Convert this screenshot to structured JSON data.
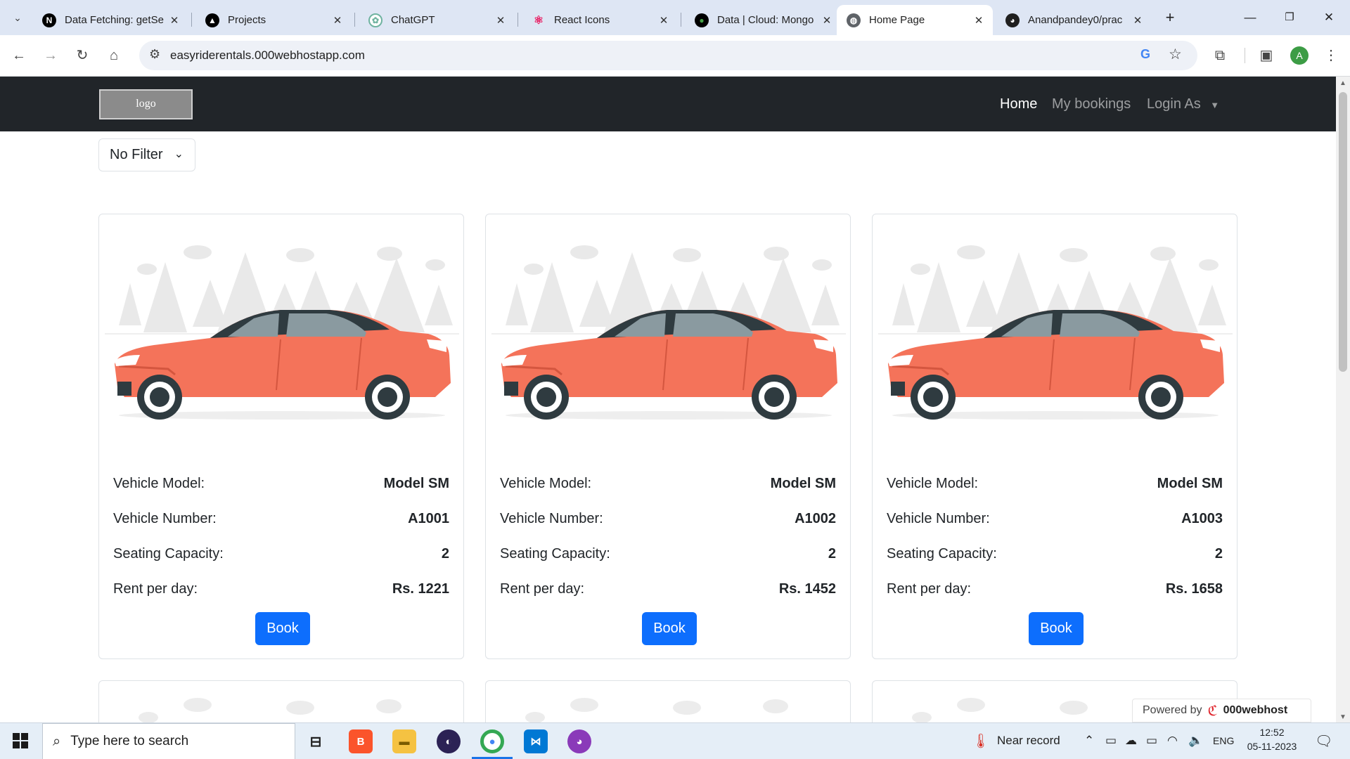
{
  "browser": {
    "tabs": [
      {
        "title": "Data Fetching: getSe",
        "icon": "nextjs-icon",
        "active": false
      },
      {
        "title": "Projects",
        "icon": "vercel-icon",
        "active": false
      },
      {
        "title": "ChatGPT",
        "icon": "chatgpt-icon",
        "active": false
      },
      {
        "title": "React Icons",
        "icon": "react-icon",
        "active": false
      },
      {
        "title": "Data | Cloud: Mongo",
        "icon": "mongodb-icon",
        "active": false
      },
      {
        "title": "Home Page",
        "icon": "globe-icon",
        "active": true
      },
      {
        "title": "Anandpandey0/prac",
        "icon": "github-icon",
        "active": false
      }
    ],
    "url": "easyriderentals.000webhostapp.com",
    "profile_initial": "A"
  },
  "site": {
    "logo_text": "logo",
    "nav": {
      "home": "Home",
      "bookings": "My bookings",
      "login": "Login As"
    },
    "filter_label": "No Filter",
    "labels": {
      "model": "Vehicle Model:",
      "number": "Vehicle Number:",
      "seats": "Seating Capacity:",
      "rent": "Rent per day:"
    },
    "book_label": "Book",
    "vehicles": [
      {
        "model": "Model SM",
        "number": "A1001",
        "seats": "2",
        "rent": "Rs. 1221"
      },
      {
        "model": "Model SM",
        "number": "A1002",
        "seats": "2",
        "rent": "Rs. 1452"
      },
      {
        "model": "Model SM",
        "number": "A1003",
        "seats": "2",
        "rent": "Rs. 1658"
      }
    ],
    "powered_by": {
      "prefix": "Powered by",
      "brand": "000webhost"
    }
  },
  "colors": {
    "navbar": "#212529",
    "primary_button": "#0d6efd",
    "car_body": "#f4735a"
  },
  "taskbar": {
    "search_placeholder": "Type here to search",
    "weather": "Near record",
    "language": "ENG",
    "time": "12:52",
    "date": "05-11-2023"
  }
}
